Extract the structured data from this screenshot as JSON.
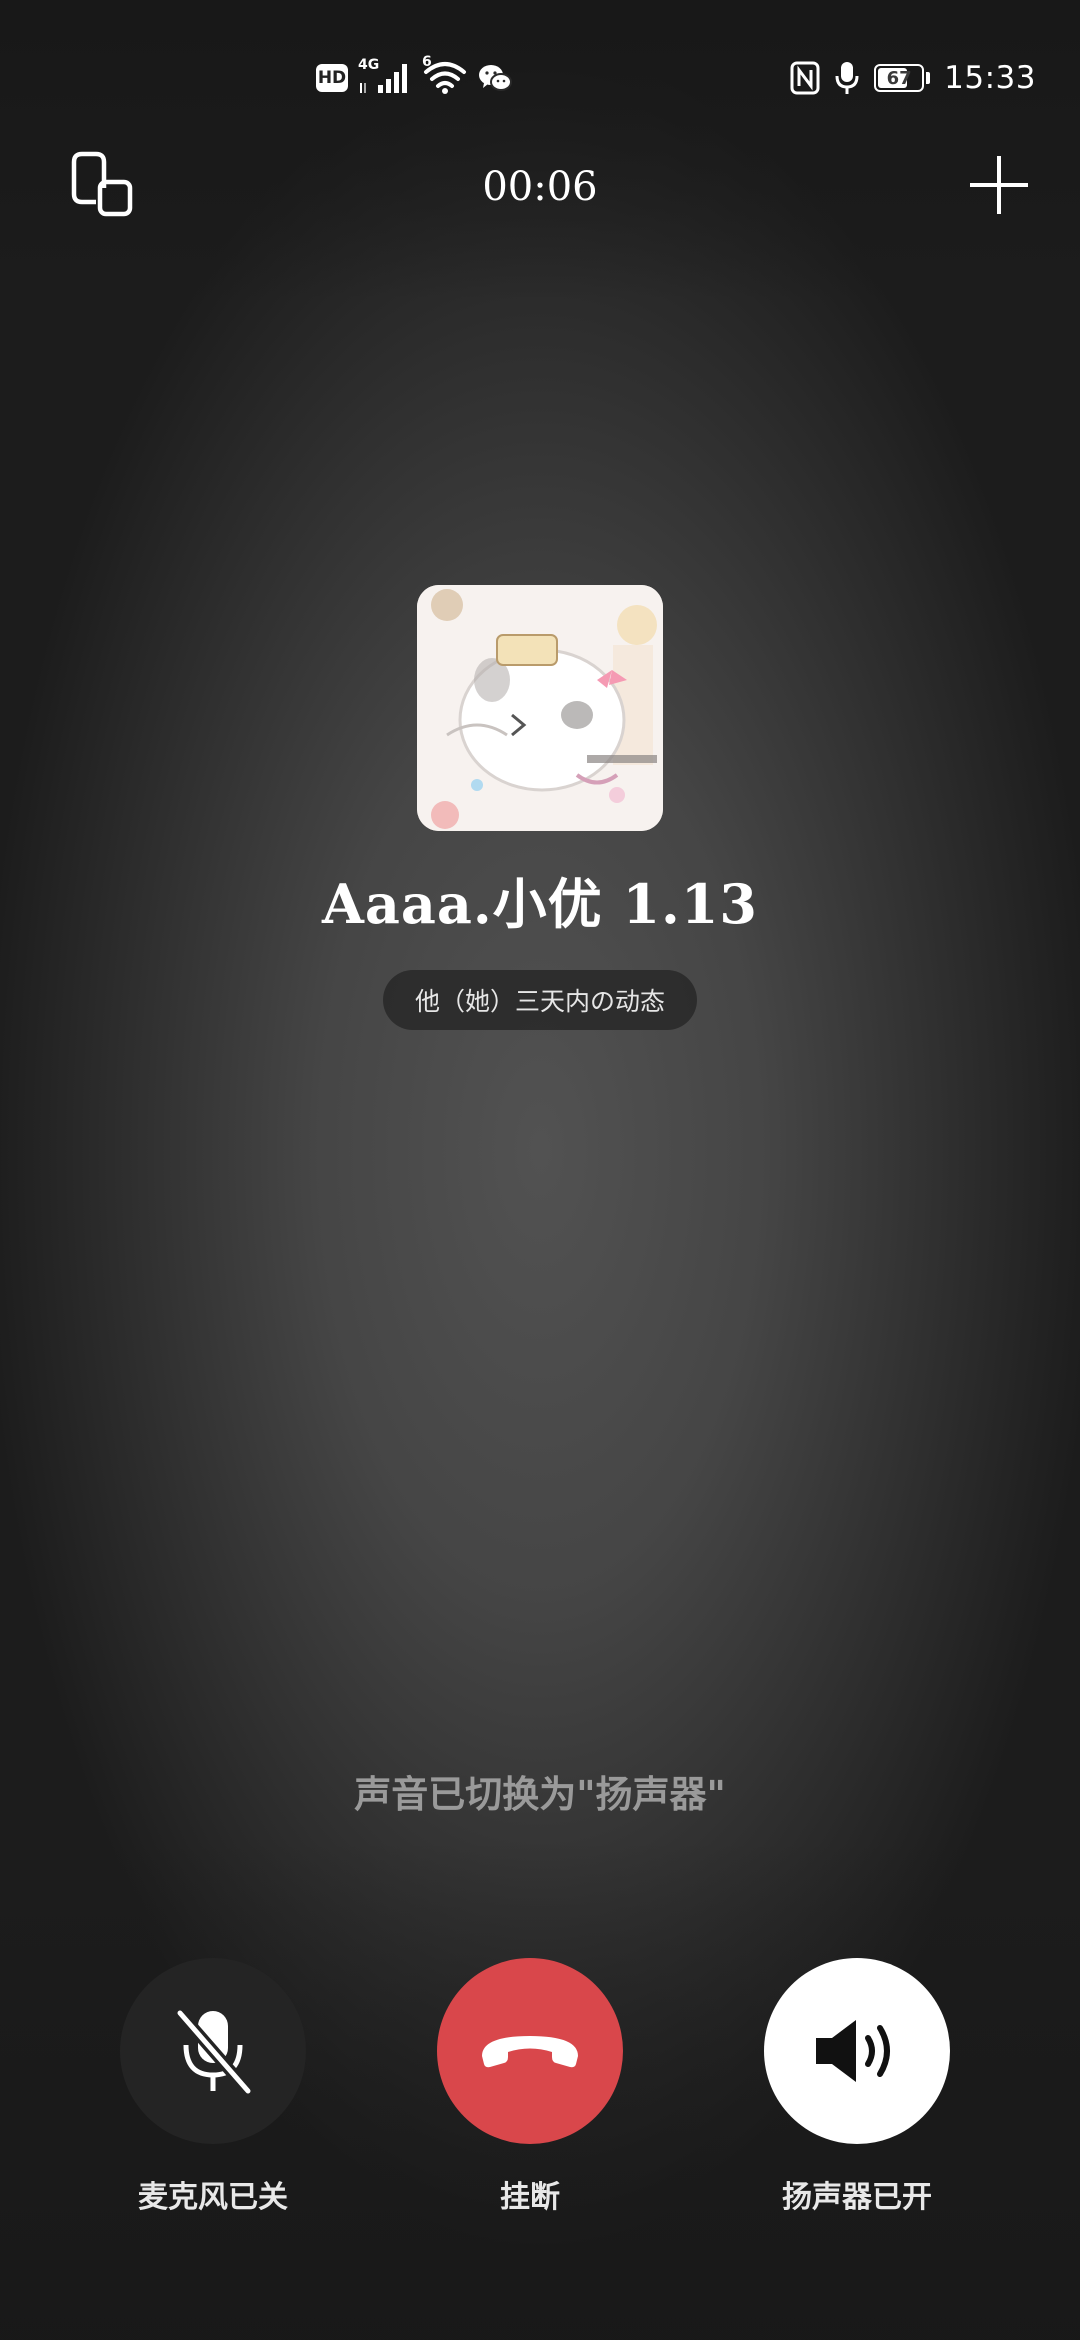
{
  "status_bar": {
    "hd_badge": "HD",
    "network_label": "4G",
    "wifi_badge": "6",
    "battery_level": "67",
    "time": "15:33",
    "left_icons": [
      "hd-icon",
      "signal-4g-icon",
      "wifi-6-icon",
      "wechat-icon"
    ],
    "right_icons": [
      "nfc-icon",
      "microphone-in-use-icon",
      "battery-icon"
    ]
  },
  "call": {
    "duration": "00:06",
    "contact_name": "Aaaa.小优  1.13",
    "moments_label": "他（她）三天内の动态",
    "toast": "声音已切换为\"扬声器\""
  },
  "controls": {
    "mic_label": "麦克风已关",
    "hangup_label": "挂断",
    "speaker_label": "扬声器已开"
  },
  "colors": {
    "hangup": "#d9474b",
    "mic_button_bg": "#242424",
    "speaker_button_bg": "#ffffff",
    "toast_text": "#9a9a9a"
  }
}
